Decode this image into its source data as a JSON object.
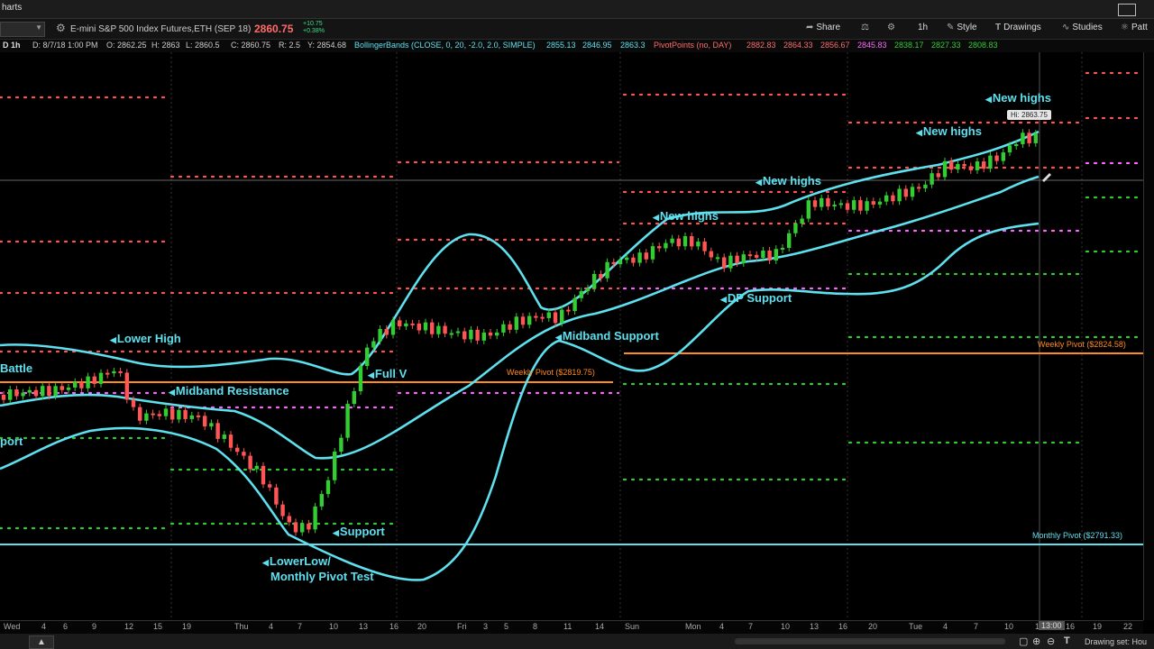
{
  "window": {
    "title": "harts"
  },
  "toolbar": {
    "symbol": "E-mini S&P 500 Index Futures,ETH (SEP 18)",
    "price": "2860.75",
    "change_abs": "+10.75",
    "change_pct": "+0.38%",
    "share_label": "Share",
    "timeframe_label": "1h",
    "style_label": "Style",
    "drawings_label": "Drawings",
    "studies_label": "Studies",
    "patterns_label": "Patt"
  },
  "infobar": {
    "aggregation": "D 1h",
    "date": "D: 8/7/18 1:00 PM",
    "open": "O: 2862.25",
    "high": "H: 2863",
    "low": "L: 2860.5",
    "close": "C: 2860.75",
    "range": "R: 2.5",
    "y": "Y: 2854.68",
    "bb_name": "BollingerBands (CLOSE, 0, 20, -2.0, 2.0, SIMPLE)",
    "bb_v1": "2855.13",
    "bb_v2": "2846.95",
    "bb_v3": "2863.3",
    "pp_name": "PivotPoints (no, DAY)",
    "pp_values": [
      "2882.83",
      "2864.33",
      "2856.67",
      "2845.83",
      "2838.17",
      "2827.33",
      "2808.83"
    ]
  },
  "annotations": {
    "battle": "Battle",
    "lower_high": "Lower High",
    "midband_resistance": "Midband Resistance",
    "support_left": "port",
    "full_v": "Full V",
    "support": "Support",
    "lower_low_1": "LowerLow/",
    "lower_low_2": "Monthly Pivot Test",
    "midband_support": "Midband Support",
    "new_highs_1": "New highs",
    "new_highs_2": "New highs",
    "new_highs_3": "New highs",
    "new_highs_4": "New highs",
    "dp_support": "DP Support"
  },
  "levels": {
    "weekly_pivot_1": "Weekly Pivot ($2819.75)",
    "weekly_pivot_2": "Weekly Pivot ($2824.58)",
    "monthly_pivot": "Monthly Pivot ($2791.33)",
    "hi_label": "Hi: 2863.75"
  },
  "time_axis": [
    "Wed",
    "4",
    "6",
    "9",
    "12",
    "15",
    "19",
    "Thu",
    "4",
    "7",
    "10",
    "13",
    "16",
    "20",
    "Fri",
    "3",
    "5",
    "8",
    "11",
    "14",
    "Sun",
    "Mon",
    "4",
    "7",
    "10",
    "13",
    "16",
    "20",
    "Tue",
    "4",
    "7",
    "10",
    "1",
    "16",
    "19",
    "22"
  ],
  "cursor_time": "13:00",
  "bottombar": {
    "drawing_set": "Drawing set: Hou"
  },
  "colors": {
    "bollinger": "#5ee0ee",
    "pivot_resistance": "#ff5555",
    "pivot_support": "#33cc33",
    "pivot_center": "#ff66ff",
    "weekly_pivot": "#ff8a1f",
    "up_candle": "#33cc33",
    "down_candle": "#ff5555"
  },
  "icons": [
    "gear-icon",
    "share-icon",
    "flask-icon",
    "settings-icon",
    "style-icon",
    "drawings-icon",
    "studies-icon",
    "pattern-icon",
    "collapse-icon",
    "zoom-in-icon",
    "zoom-out-icon",
    "text-icon"
  ]
}
